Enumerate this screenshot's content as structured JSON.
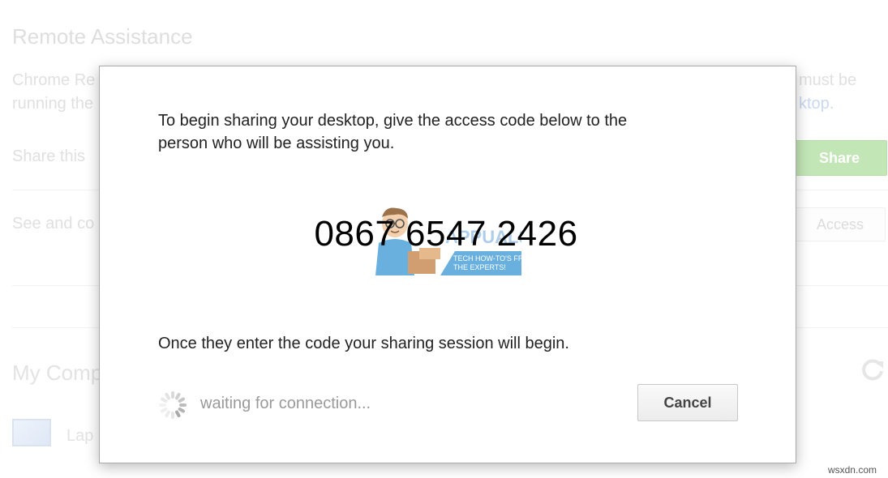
{
  "background": {
    "title": "Remote Assistance",
    "description_left_1": "Chrome Re",
    "description_left_2": "running the",
    "description_right_1": "must be",
    "description_right_2": "ktop",
    "description_right_2_suffix": ".",
    "share_row_label": "Share this",
    "share_button": "Share",
    "access_row_label": "See and co",
    "access_button": "Access",
    "section_title": "My Comp",
    "computer_item_label": "Lap",
    "share_button_color": "#c3e6b6"
  },
  "dialog": {
    "instructions_line_1": "To begin sharing your desktop, give the access code below to the",
    "instructions_line_2": "person who will be assisting you.",
    "access_code": "0867 6547 2426",
    "watermark": {
      "brand": "APPUALS",
      "tagline_1": "TECH HOW-TO'S FROM",
      "tagline_2": "THE EXPERTS!"
    },
    "begin_text": "Once they enter the code your sharing session will begin.",
    "status_icon": "spinner-icon",
    "status_text": "waiting for connection...",
    "cancel_button": "Cancel"
  },
  "site_credit": "wsxdn.com"
}
